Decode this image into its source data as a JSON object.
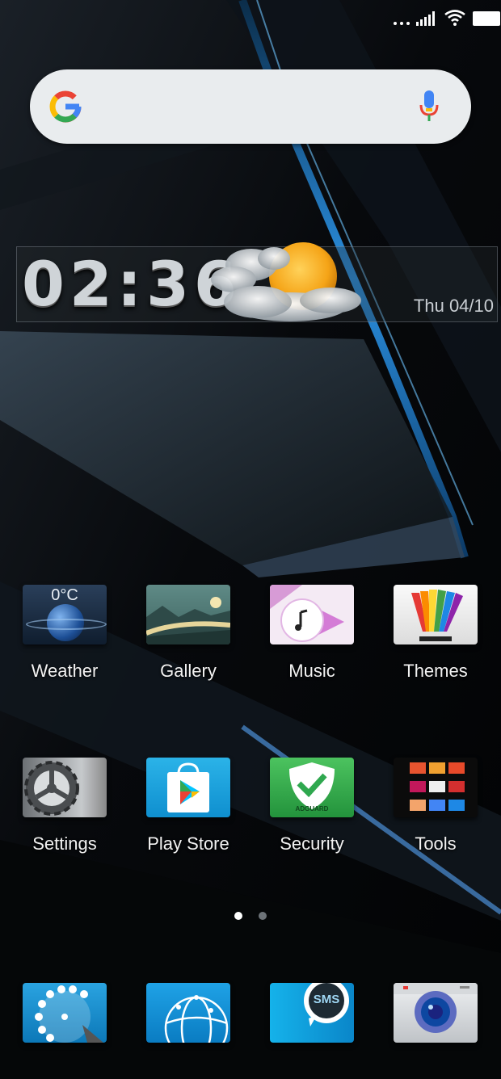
{
  "status_bar": {
    "overflow_icon": "more-dots-icon",
    "signal_icon": "cell-signal-icon",
    "wifi_icon": "wifi-icon",
    "battery_icon": "battery-icon"
  },
  "search": {
    "logo_icon": "google-g-icon",
    "mic_icon": "microphone-icon"
  },
  "clock": {
    "time": "02:36",
    "date": "Thu 04/10",
    "weather_icon": "sun-behind-cloud-icon"
  },
  "apps_row1": [
    {
      "label": "Weather",
      "temp": "0°C",
      "icon": "weather-globe-icon"
    },
    {
      "label": "Gallery",
      "icon": "landscape-icon"
    },
    {
      "label": "Music",
      "icon": "music-note-icon"
    },
    {
      "label": "Themes",
      "icon": "rainbow-fan-icon"
    }
  ],
  "apps_row2": [
    {
      "label": "Settings",
      "icon": "gear-icon"
    },
    {
      "label": "Play Store",
      "icon": "play-store-icon"
    },
    {
      "label": "Security",
      "icon": "adguard-shield-icon",
      "brand": "ADGUARD"
    },
    {
      "label": "Tools",
      "icon": "folder-grid-icon"
    }
  ],
  "page_indicator": {
    "active_page": 1,
    "total_pages": 2
  },
  "dock": [
    {
      "icon": "rotary-phone-icon"
    },
    {
      "icon": "globe-browser-icon"
    },
    {
      "icon": "sms-bubble-icon",
      "text": "SMS"
    },
    {
      "icon": "camera-icon"
    }
  ],
  "colors": {
    "accent_blue": "#1a8fd6",
    "security_green": "#2fa84f",
    "search_bar": "#e9ecee"
  }
}
